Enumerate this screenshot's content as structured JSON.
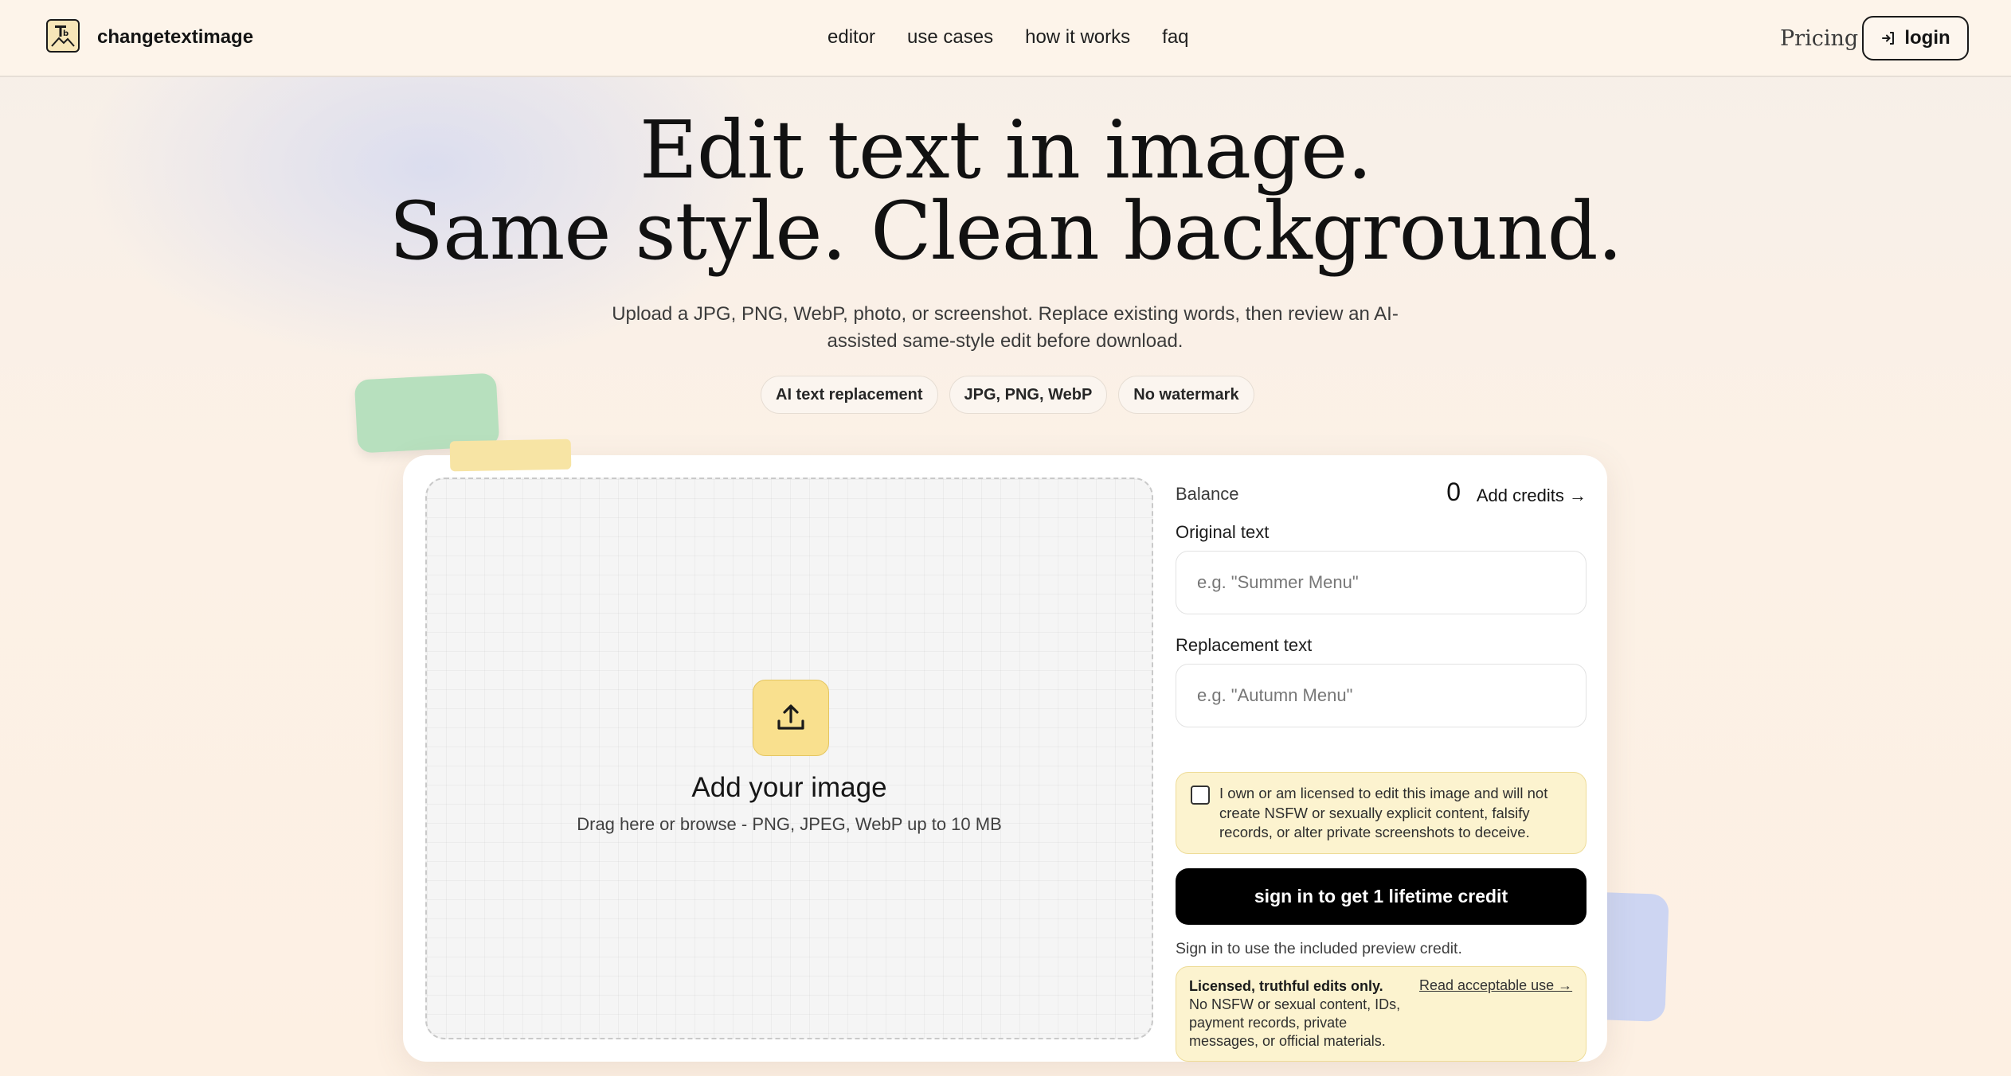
{
  "header": {
    "brand": "changetextimage",
    "nav": [
      "editor",
      "use cases",
      "how it works",
      "faq"
    ],
    "pricing_label": "Pricing",
    "login_label": "login"
  },
  "hero": {
    "title_line1": "Edit text in image.",
    "title_line2": "Same style. Clean background.",
    "subtitle": "Upload a JPG, PNG, WebP, photo, or screenshot. Replace existing words, then review an AI-assisted same-style edit before download.",
    "chips": [
      "AI text replacement",
      "JPG, PNG, WebP",
      "No watermark"
    ]
  },
  "dropzone": {
    "title": "Add your image",
    "subtitle": "Drag here or browse - PNG, JPEG, WebP up to 10 MB"
  },
  "panel": {
    "balance_label": "Balance",
    "balance_value": "0",
    "add_credits": "Add credits →",
    "original_label": "Original text",
    "original_placeholder": "e.g. \"Summer Menu\"",
    "replacement_label": "Replacement text",
    "replacement_placeholder": "e.g. \"Autumn Menu\"",
    "consent": "I own or am licensed to edit this image and will not create NSFW or sexually explicit content, falsify records, or alter private screenshots to deceive.",
    "signin_button": "sign in to get 1 lifetime credit",
    "signin_note": "Sign in to use the included preview credit.",
    "policy_bold": "Licensed, truthful edits only.",
    "policy_text": " No NSFW or sexual content, IDs, payment records, private messages, or official materials.",
    "policy_link": "Read acceptable use →"
  },
  "colors": {
    "accent_yellow": "#f9e08e",
    "notice_bg": "#fcf3cf",
    "primary_button": "#000000",
    "page_bg": "#fdf3ea"
  },
  "icons": [
    "logo-icon",
    "login-arrow-icon",
    "upload-icon"
  ]
}
